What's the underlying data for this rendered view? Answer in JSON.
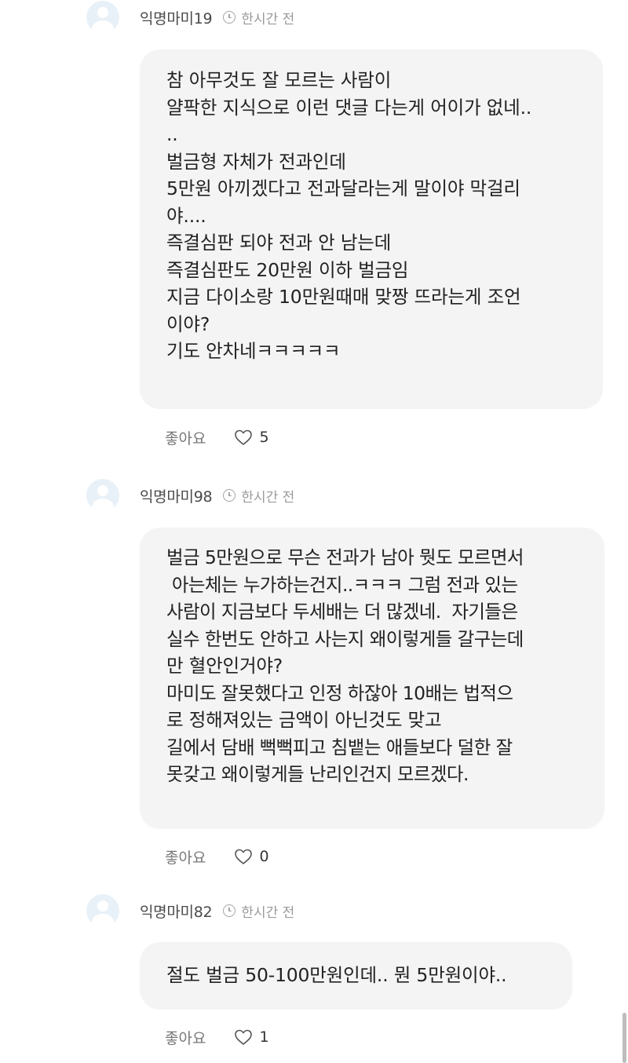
{
  "comments": [
    {
      "author": "익명마미19",
      "time": "한시간 전",
      "lines": [
        "참 아무것도 잘 모르는 사람이",
        "얄팍한 지식으로 이런 댓글 다는게 어이가 없네..",
        "..",
        "벌금형 자체가 전과인데",
        "5만원 아끼겠다고 전과달라는게 말이야 막걸리",
        "야....",
        "즉결심판 되야 전과 안 남는데",
        "즉결심판도 20만원 이하 벌금임",
        "지금 다이소랑 10만원때매 맞짱 뜨라는게 조언",
        "이야?",
        "기도 안차네ㅋㅋㅋㅋㅋ"
      ],
      "like_label": "좋아요",
      "like_count": "5"
    },
    {
      "author": "익명마미98",
      "time": "한시간 전",
      "lines": [
        "벌금 5만원으로 무슨 전과가 남아 뭣도 모르면서",
        " 아는체는 누가하는건지..ㅋㅋㅋ 그럼 전과 있는",
        "사람이 지금보다 두세배는 더 많겠네.  자기들은",
        "실수 한번도 안하고 사는지 왜이렇게들 갈구는데",
        "만 혈안인거야?",
        "마미도 잘못했다고 인정 하잖아 10배는 법적으",
        "로 정해져있는 금액이 아닌것도 맞고",
        "길에서 담배 뻑뻑피고 침뱉는 애들보다 덜한 잘",
        "못갖고 왜이렇게들 난리인건지 모르겠다."
      ],
      "like_label": "좋아요",
      "like_count": "0"
    },
    {
      "author": "익명마미82",
      "time": "한시간 전",
      "lines": [
        "절도 벌금 50-100만원인데.. 뭔 5만원이야.."
      ],
      "like_label": "좋아요",
      "like_count": "1"
    }
  ],
  "icons": {
    "avatar": "default-user-avatar",
    "time": "clock-icon",
    "like": "heart-outline-icon"
  },
  "colors": {
    "bubble_bg": "#f4f4f5",
    "avatar_bg": "#e9f1f8",
    "meta_text": "#9a9a9a"
  }
}
